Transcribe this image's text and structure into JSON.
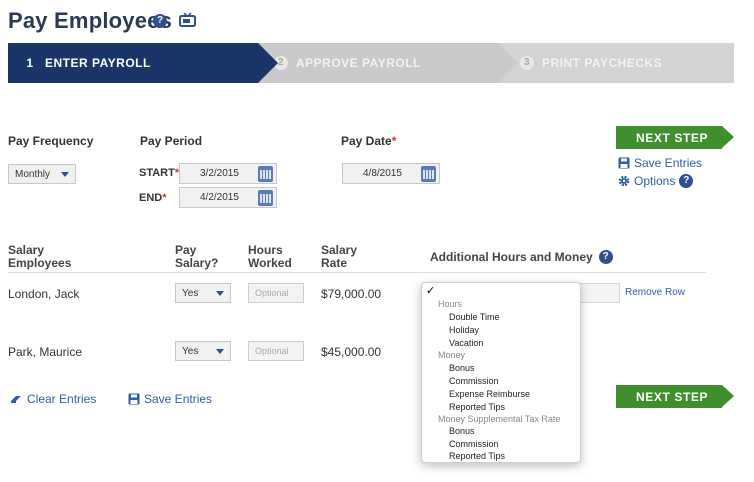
{
  "header": {
    "title": "Pay Employees",
    "help_icon": "question-circle",
    "video_icon": "tv-icon"
  },
  "steps": [
    {
      "num": "1",
      "label": "ENTER PAYROLL",
      "active": true
    },
    {
      "num": "2",
      "label": "APPROVE PAYROLL",
      "active": false
    },
    {
      "num": "3",
      "label": "PRINT PAYCHECKS",
      "active": false
    }
  ],
  "form": {
    "pay_frequency_label": "Pay Frequency",
    "pay_frequency_value": "Monthly",
    "pay_period_label": "Pay Period",
    "start_label": "START",
    "start_value": "3/2/2015",
    "end_label": "END",
    "end_value": "4/2/2015",
    "pay_date_label": "Pay Date",
    "pay_date_value": "4/8/2015",
    "required_mark": "*"
  },
  "actions": {
    "next_step": "NEXT STEP",
    "save_entries": "Save Entries",
    "options": "Options",
    "clear_entries": "Clear Entries",
    "remove_row": "Remove Row"
  },
  "table": {
    "headers": {
      "salary_employees_1": "Salary",
      "salary_employees_2": "Employees",
      "pay_salary_1": "Pay",
      "pay_salary_2": "Salary?",
      "hours_worked_1": "Hours",
      "hours_worked_2": "Worked",
      "salary_rate_1": "Salary",
      "salary_rate_2": "Rate",
      "additional": "Additional Hours and Money"
    },
    "rows": [
      {
        "name": "London, Jack",
        "pay_salary": "Yes",
        "hours_placeholder": "Optional",
        "rate": "$79,000.00"
      },
      {
        "name": "Park, Maurice",
        "pay_salary": "Yes",
        "hours_placeholder": "Optional",
        "rate": "$45,000.00"
      }
    ]
  },
  "dropdown": {
    "checkmark": "✓",
    "items": [
      {
        "text": "Hours",
        "group": true
      },
      {
        "text": "Double Time",
        "group": false
      },
      {
        "text": "Holiday",
        "group": false
      },
      {
        "text": "Vacation",
        "group": false
      },
      {
        "text": "Money",
        "group": true
      },
      {
        "text": "Bonus",
        "group": false
      },
      {
        "text": "Commission",
        "group": false
      },
      {
        "text": "Expense Reimburse",
        "group": false
      },
      {
        "text": "Reported Tips",
        "group": false
      },
      {
        "text": "Money Supplemental Tax Rate",
        "group": true
      },
      {
        "text": "Bonus",
        "group": false
      },
      {
        "text": "Commission",
        "group": false
      },
      {
        "text": "Reported Tips",
        "group": false
      }
    ]
  },
  "colors": {
    "navy": "#1a3668",
    "green": "#3f8f2e",
    "link": "#2f5da8"
  }
}
